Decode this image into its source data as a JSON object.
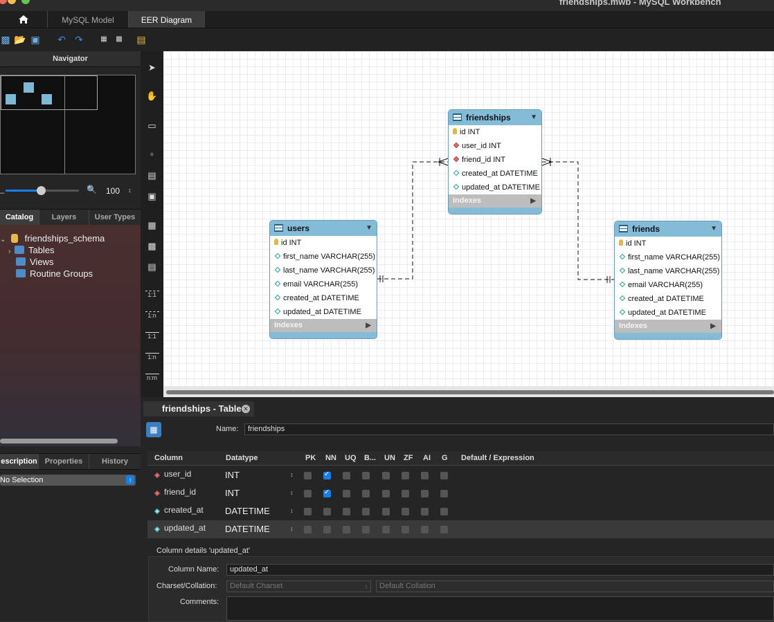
{
  "window": {
    "title": "friendships.mwb - MySQL Workbench"
  },
  "tabs": [
    {
      "label": "MySQL Model"
    },
    {
      "label": "EER Diagram"
    }
  ],
  "navigator": {
    "title": "Navigator",
    "zoom": "100"
  },
  "sidebar_tabs": [
    "Catalog",
    "Layers",
    "User Types"
  ],
  "catalog": {
    "schema": "friendships_schema",
    "items": [
      "Tables",
      "Views",
      "Routine Groups"
    ]
  },
  "bottom_tabs": [
    "escription",
    "Properties",
    "History"
  ],
  "selection": "No Selection",
  "tools": {
    "rel_11": "1:1",
    "rel_1n": "1:n",
    "rel_11b": "1:1",
    "rel_1nb": "1:n",
    "rel_nm": "n:m"
  },
  "diagram": {
    "friendships": {
      "title": "friendships",
      "columns": [
        "id INT",
        "user_id INT",
        "friend_id INT",
        "created_at DATETIME",
        "updated_at DATETIME"
      ],
      "indexes": "Indexes"
    },
    "users": {
      "title": "users",
      "columns": [
        "id INT",
        "first_name VARCHAR(255)",
        "last_name VARCHAR(255)",
        "email VARCHAR(255)",
        "created_at DATETIME",
        "updated_at DATETIME"
      ],
      "indexes": "Indexes"
    },
    "friends": {
      "title": "friends",
      "columns": [
        "id INT",
        "first_name VARCHAR(255)",
        "last_name VARCHAR(255)",
        "email VARCHAR(255)",
        "created_at DATETIME",
        "updated_at DATETIME"
      ],
      "indexes": "Indexes"
    }
  },
  "editor": {
    "tab_title": "friendships - Table",
    "name_label": "Name:",
    "name_value": "friendships",
    "headers": [
      "Column",
      "Datatype",
      "PK",
      "NN",
      "UQ",
      "B...",
      "UN",
      "ZF",
      "AI",
      "G",
      "Default / Expression"
    ],
    "rows": [
      {
        "name": "user_id",
        "type": "INT",
        "nn": true
      },
      {
        "name": "friend_id",
        "type": "INT",
        "nn": true
      },
      {
        "name": "created_at",
        "type": "DATETIME",
        "nn": false
      },
      {
        "name": "updated_at",
        "type": "DATETIME",
        "nn": false
      }
    ],
    "details_title": "Column details 'updated_at'",
    "column_name_label": "Column Name:",
    "column_name_value": "updated_at",
    "charset_label": "Charset/Collation:",
    "charset_value": "Default Charset",
    "collation_value": "Default Collation",
    "comments_label": "Comments:"
  },
  "colors": {
    "table_header": "#84bbd6",
    "checkbox_on": "#1a7ee6",
    "fk_diamond": "#e07070"
  }
}
